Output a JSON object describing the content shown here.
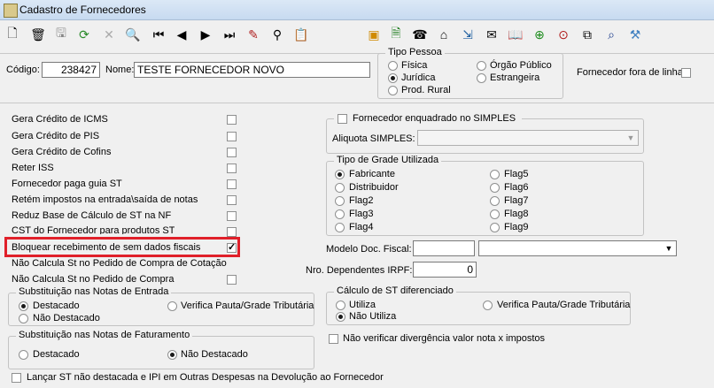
{
  "window": {
    "title": "Cadastro de Fornecedores"
  },
  "toolbar": {
    "icons": [
      "new-icon",
      "delete-icon",
      "save-icon",
      "refresh-icon",
      "cancel-icon",
      "search-icon",
      "first-record-icon",
      "previous-record-icon",
      "next-record-icon",
      "last-record-icon",
      "edit-icon",
      "find-icon",
      "paste-icon",
      "note-icon",
      "add-document-icon",
      "phone-icon",
      "history-icon",
      "export-icon",
      "envelope-icon",
      "book-icon",
      "target-icon",
      "target-red-icon",
      "copy-icon",
      "zoom-icon",
      "tools-icon"
    ]
  },
  "header": {
    "codigo_label": "Código:",
    "codigo_value": "238427",
    "nome_label": "Nome:",
    "nome_value": "TESTE FORNECEDOR NOVO",
    "tipo_pessoa": {
      "title": "Tipo Pessoa",
      "options": [
        "Física",
        "Jurídica",
        "Prod. Rural",
        "Órgão Público",
        "Estrangeira"
      ],
      "selected": "Jurídica"
    },
    "fora_de_linha_label": "Fornecedor fora de linha"
  },
  "left_checks": [
    {
      "label": "Gera Crédito de ICMS",
      "checked": false
    },
    {
      "label": "Gera Crédito de PIS",
      "checked": false
    },
    {
      "label": "Gera Crédito de Cofins",
      "checked": false
    },
    {
      "label": "Reter ISS",
      "checked": false
    },
    {
      "label": "Fornecedor paga guia ST",
      "checked": false
    },
    {
      "label": "Retém impostos na entrada\\saída de notas",
      "checked": false
    },
    {
      "label": "Reduz Base de Cálculo de ST na NF",
      "checked": false
    },
    {
      "label": "CST do Fornecedor para produtos ST",
      "checked": false
    },
    {
      "label": "Bloquear recebimento de sem dados fiscais",
      "checked": true
    },
    {
      "label": "Não Calcula St no Pedido de Compra de Cotação",
      "checked": false
    },
    {
      "label": "Não Calcula St no Pedido de Compra",
      "checked": false
    }
  ],
  "subst_entrada": {
    "title": "Substituição nas Notas de Entrada",
    "options": [
      "Destacado",
      "Não Destacado",
      "Verifica Pauta/Grade Tributária"
    ],
    "selected": "Destacado"
  },
  "subst_faturamento": {
    "title": "Substituição nas Notas de Faturamento",
    "options": [
      "Destacado",
      "Não Destacado"
    ],
    "selected": "Não Destacado"
  },
  "lancar_st_label": "Lançar ST não destacada e IPI em Outras Despesas na Devolução ao Fornecedor",
  "simples": {
    "title": "Fornecedor enquadrado no SIMPLES",
    "aliquota_label": "Aliquota SIMPLES:",
    "aliquota_value": ""
  },
  "grade": {
    "title": "Tipo de Grade Utilizada",
    "options": [
      "Fabricante",
      "Distribuidor",
      "Flag2",
      "Flag3",
      "Flag4",
      "Flag5",
      "Flag6",
      "Flag7",
      "Flag8",
      "Flag9"
    ],
    "selected": "Fabricante"
  },
  "modelo_doc": {
    "label": "Modelo Doc. Fiscal:",
    "code": "",
    "value": ""
  },
  "dependentes": {
    "label": "Nro. Dependentes IRPF:",
    "value": "0"
  },
  "calculo_st": {
    "title": "Cálculo de ST diferenciado",
    "options": [
      "Utiliza",
      "Não Utiliza",
      "Verifica Pauta/Grade Tributária"
    ],
    "selected": "Não Utiliza"
  },
  "nao_verificar_label": "Não verificar divergência valor nota x impostos"
}
